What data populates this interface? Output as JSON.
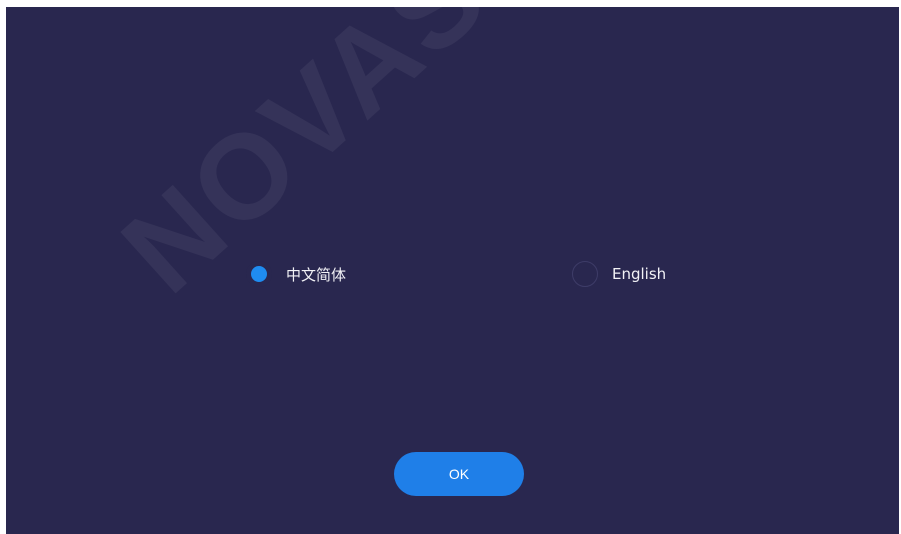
{
  "language_picker": {
    "options": [
      {
        "label": "中文简体",
        "selected": true
      },
      {
        "label": "English",
        "selected": false
      }
    ],
    "ok_label": "OK"
  },
  "watermark": "NOVASTAR TE",
  "colors": {
    "background": "#29274f",
    "accent": "#1f8cf0",
    "text": "#f2f2f6"
  }
}
